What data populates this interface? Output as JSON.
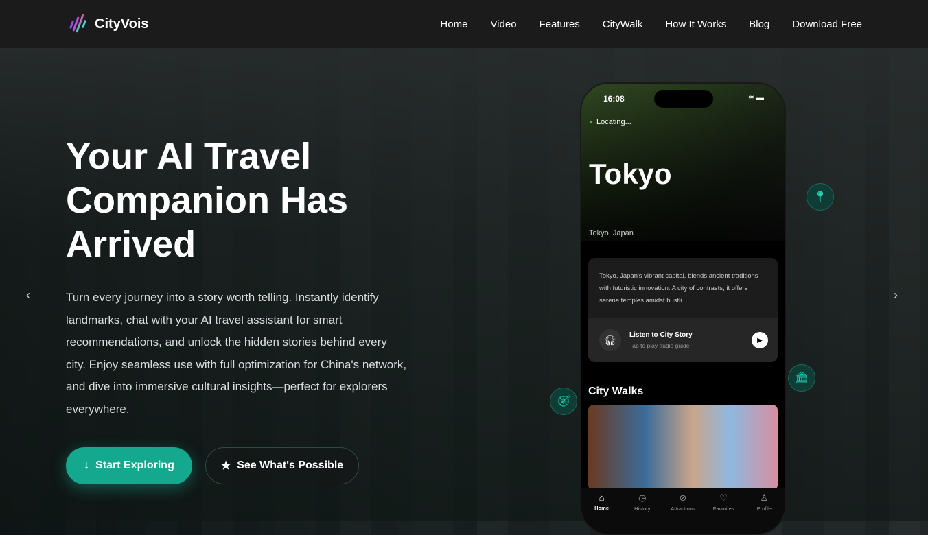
{
  "brand": {
    "name": "CityVois"
  },
  "nav": {
    "items": [
      "Home",
      "Video",
      "Features",
      "CityWalk",
      "How It Works",
      "Blog",
      "Download Free"
    ]
  },
  "hero": {
    "title": "Your AI Travel Companion Has Arrived",
    "description": "Turn every journey into a story worth telling. Instantly identify landmarks, chat with your AI travel assistant for smart recommendations, and unlock the hidden stories behind every city. Enjoy seamless use with full optimization for China's network, and dive into immersive cultural insights—perfect for explorers everywhere.",
    "primary_button": "Start Exploring",
    "secondary_button": "See What's Possible"
  },
  "phone": {
    "time": "16:08",
    "status": "Locating...",
    "city": "Tokyo",
    "country": "Tokyo, Japan",
    "summary": "Tokyo, Japan's vibrant capital, blends ancient traditions with futuristic innovation. A city of contrasts, it offers serene temples amidst bustli...",
    "listen_title": "Listen to City Story",
    "listen_sub": "Tap to play audio guide",
    "section": "City Walks",
    "tabs": [
      "Home",
      "History",
      "Attractions",
      "Favorites",
      "Profile"
    ]
  },
  "colors": {
    "accent": "#14a88f"
  }
}
